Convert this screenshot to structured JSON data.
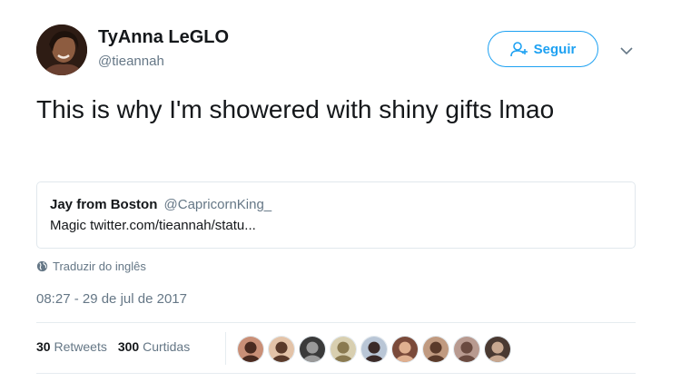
{
  "author": {
    "name": "TyAnna LeGLO",
    "handle": "@tieannah"
  },
  "follow_button": {
    "label": "Seguir",
    "icon": "add-user-icon",
    "color": "#1da1f2"
  },
  "menu_icon": "chevron-down-icon",
  "tweet": {
    "text": "This is why I'm showered with shiny gifts lmao"
  },
  "quoted_tweet": {
    "name": "Jay from Boston",
    "handle": "@CapricornKing_",
    "text": "Magic twitter.com/tieannah/statu..."
  },
  "translate": {
    "icon": "globe-icon",
    "label": "Traduzir do inglês"
  },
  "timestamp": "08:27 - 29 de jul de 2017",
  "stats": {
    "retweets_count": "30",
    "retweets_label": "Retweets",
    "likes_count": "300",
    "likes_label": "Curtidas"
  },
  "liker_avatars": [
    {
      "bg": "#c98f77",
      "fg": "#4a2a20"
    },
    {
      "bg": "#e3c3a8",
      "fg": "#5a3a2a"
    },
    {
      "bg": "#3a3a3a",
      "fg": "#9a9a9a"
    },
    {
      "bg": "#d8cfb0",
      "fg": "#8a7a50"
    },
    {
      "bg": "#b9c6d6",
      "fg": "#3a2a28"
    },
    {
      "bg": "#7a4a3a",
      "fg": "#e0b090"
    },
    {
      "bg": "#c09a80",
      "fg": "#5a3a2a"
    },
    {
      "bg": "#b89a90",
      "fg": "#6a4a40"
    },
    {
      "bg": "#4a3a32",
      "fg": "#c8a890"
    }
  ]
}
